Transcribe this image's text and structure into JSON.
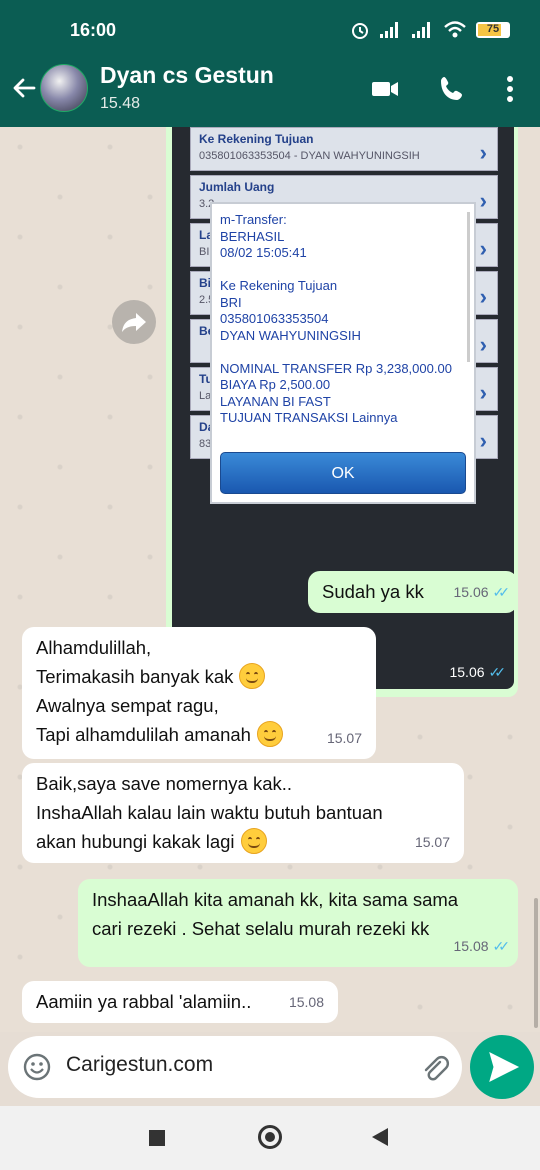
{
  "status": {
    "time": "16:00",
    "battery": "75"
  },
  "header": {
    "title": "Dyan cs Gestun",
    "subtitle": "15.48"
  },
  "image_message": {
    "rows": [
      {
        "label": "Ke Rekening Tujuan",
        "value": "035801063353504 - DYAN WAHYUNINGSIH"
      },
      {
        "label": "Jumlah Uang",
        "value": "3.2"
      },
      {
        "label": "Lay",
        "value": "BI"
      },
      {
        "label": "Bia",
        "value": "2.5"
      },
      {
        "label": "Be",
        "value": ""
      },
      {
        "label": "Tuj",
        "value": "La"
      },
      {
        "label": "Da",
        "value": "83"
      }
    ],
    "dialog": {
      "lines": [
        "m-Transfer:",
        "BERHASIL",
        "08/02 15:05:41",
        "",
        "Ke Rekening Tujuan",
        "BRI",
        "035801063353504",
        "DYAN WAHYUNINGSIH",
        "",
        "NOMINAL TRANSFER Rp 3,238,000.00",
        "BIAYA Rp 2,500.00",
        "LAYANAN BI FAST",
        "TUJUAN TRANSAKSI Lainnya"
      ],
      "ok_label": "OK"
    },
    "time": "15.06"
  },
  "messages": [
    {
      "dir": "out",
      "text": "Sudah ya kk",
      "time": "15.06"
    },
    {
      "dir": "in",
      "lines": [
        "Alhamdulillah,",
        "Terimakasih banyak kak",
        "Awalnya sempat ragu,",
        "Tapi alhamdulilah amanah"
      ],
      "time": "15.07"
    },
    {
      "dir": "in",
      "lines": [
        "Baik,saya save nomernya kak..",
        "InshaAllah kalau lain waktu butuh bantuan",
        "akan hubungi kakak lagi"
      ],
      "time": "15.07"
    },
    {
      "dir": "out",
      "lines": [
        "InshaaAllah kita amanah kk, kita sama sama",
        "cari rezeki . Sehat selalu murah rezeki kk"
      ],
      "time": "15.08"
    },
    {
      "dir": "in",
      "text": "Aamiin ya rabbal 'alamiin..",
      "time": "15.08"
    }
  ],
  "composer": {
    "value": "Carigestun.com"
  },
  "colors": {
    "header": "#0b5d53",
    "outgoing": "#d9fdd3",
    "incoming": "#ffffff",
    "send": "#00a884",
    "read_ticks": "#53bdeb"
  },
  "icons": [
    "back-arrow-icon",
    "video-call-icon",
    "phone-icon",
    "more-vert-icon",
    "forward-icon",
    "emoji-icon",
    "attach-icon",
    "send-icon"
  ]
}
